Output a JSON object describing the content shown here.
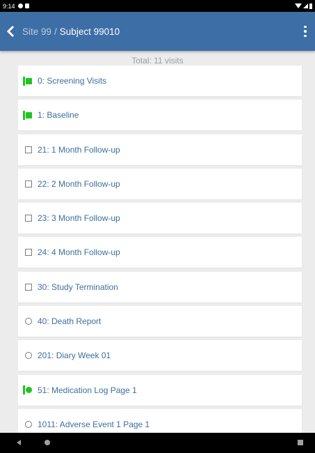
{
  "status_bar": {
    "time": "9:14"
  },
  "header": {
    "breadcrumb_site": "Site 99",
    "breadcrumb_separator": "/",
    "breadcrumb_subject": "Subject 99010"
  },
  "summary": {
    "total": "Total: 11 visits"
  },
  "colors": {
    "app_bar": "#3d6ea6",
    "complete_green": "#22c322",
    "link_blue": "#3e6e9e"
  },
  "visits": [
    {
      "label": "0: Screening Visits",
      "icon": "flag-square-icon"
    },
    {
      "label": "1: Baseline",
      "icon": "flag-square-icon"
    },
    {
      "label": "21: 1 Month Follow-up",
      "icon": "empty-square-icon"
    },
    {
      "label": "22: 2 Month Follow-up",
      "icon": "empty-square-icon"
    },
    {
      "label": "23: 3 Month Follow-up",
      "icon": "empty-square-icon"
    },
    {
      "label": "24: 4 Month Follow-up",
      "icon": "empty-square-icon"
    },
    {
      "label": "30: Study Termination",
      "icon": "empty-square-icon"
    },
    {
      "label": "40: Death Report",
      "icon": "empty-circle-icon"
    },
    {
      "label": "201: Diary Week 01",
      "icon": "empty-circle-icon"
    },
    {
      "label": "51: Medication Log Page 1",
      "icon": "flag-circle-icon"
    },
    {
      "label": "1011: Adverse Event 1 Page 1",
      "icon": "empty-circle-icon"
    }
  ]
}
